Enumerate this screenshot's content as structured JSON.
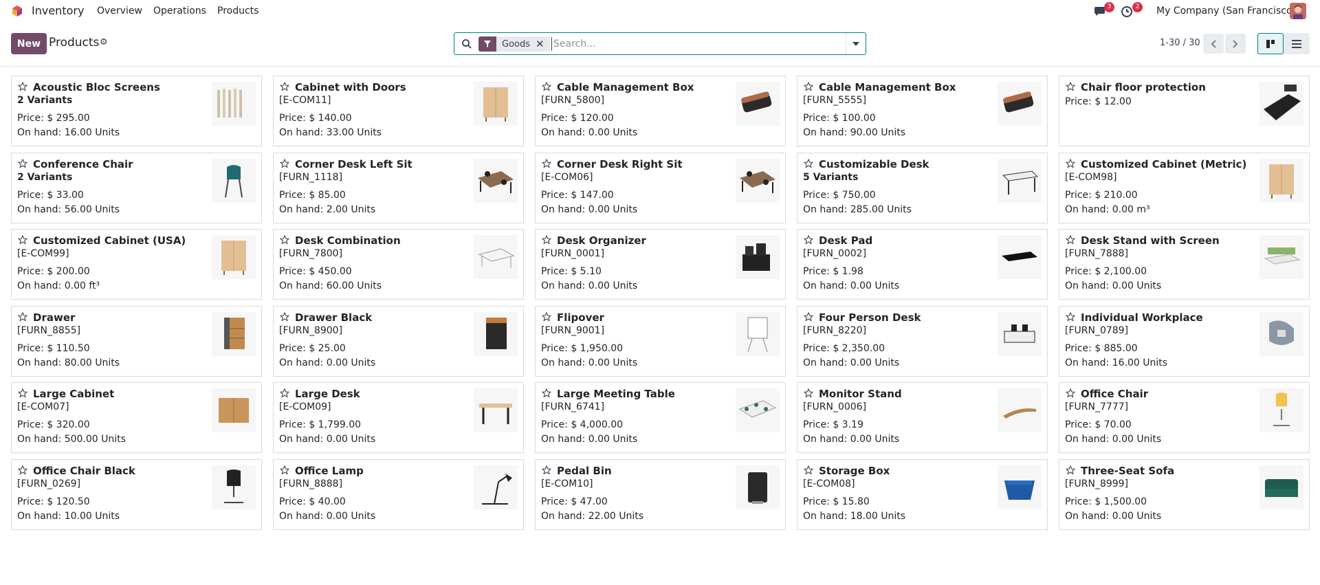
{
  "navbar": {
    "app_name": "Inventory",
    "menu": [
      "Overview",
      "Operations",
      "Products"
    ],
    "messages_count": "3",
    "activities_count": "2",
    "company": "My Company (San Francisco)"
  },
  "control": {
    "new_label": "New",
    "title": "Products",
    "facet_label": "Goods",
    "search_placeholder": "Search...",
    "pager": "1-30 / 30"
  },
  "colors": {
    "brand": "#714b67",
    "accent": "#017e84",
    "badge": "#d6334b"
  },
  "products": [
    {
      "name": "Acoustic Bloc Screens",
      "ref": "2 Variants",
      "variants": true,
      "price": "Price: $ 295.00",
      "onhand": "On hand: 16.00 Units",
      "icon": "acoustic-screen-icon"
    },
    {
      "name": "Cabinet with Doors",
      "ref": "[E-COM11]",
      "variants": false,
      "price": "Price: $ 140.00",
      "onhand": "On hand: 33.00 Units",
      "icon": "cabinet-icon"
    },
    {
      "name": "Cable Management Box",
      "ref": "[FURN_5800]",
      "variants": false,
      "price": "Price: $ 120.00",
      "onhand": "On hand: 0.00 Units",
      "icon": "cable-box-icon"
    },
    {
      "name": "Cable Management Box",
      "ref": "[FURN_5555]",
      "variants": false,
      "price": "Price: $ 100.00",
      "onhand": "On hand: 90.00 Units",
      "icon": "cable-box-icon"
    },
    {
      "name": "Chair floor protection",
      "ref": "",
      "variants": false,
      "price": "Price: $ 12.00",
      "onhand": "",
      "icon": "floor-mat-icon"
    },
    {
      "name": "Conference Chair",
      "ref": "2 Variants",
      "variants": true,
      "price": "Price: $ 33.00",
      "onhand": "On hand: 56.00 Units",
      "icon": "chair-icon"
    },
    {
      "name": "Corner Desk Left Sit",
      "ref": "[FURN_1118]",
      "variants": false,
      "price": "Price: $ 85.00",
      "onhand": "On hand: 2.00 Units",
      "icon": "corner-desk-icon"
    },
    {
      "name": "Corner Desk Right Sit",
      "ref": "[E-COM06]",
      "variants": false,
      "price": "Price: $ 147.00",
      "onhand": "On hand: 0.00 Units",
      "icon": "corner-desk-icon"
    },
    {
      "name": "Customizable Desk",
      "ref": "5 Variants",
      "variants": true,
      "price": "Price: $ 750.00",
      "onhand": "On hand: 285.00 Units",
      "icon": "desk-icon"
    },
    {
      "name": "Customized Cabinet (Metric)",
      "ref": "[E-COM98]",
      "variants": false,
      "price": "Price: $ 210.00",
      "onhand": "On hand: 0.00 m³",
      "icon": "cabinet-icon"
    },
    {
      "name": "Customized Cabinet (USA)",
      "ref": "[E-COM99]",
      "variants": false,
      "price": "Price: $ 200.00",
      "onhand": "On hand: 0.00 ft³",
      "icon": "cabinet-icon"
    },
    {
      "name": "Desk Combination",
      "ref": "[FURN_7800]",
      "variants": false,
      "price": "Price: $ 450.00",
      "onhand": "On hand: 60.00 Units",
      "icon": "desk-combination-icon"
    },
    {
      "name": "Desk Organizer",
      "ref": "[FURN_0001]",
      "variants": false,
      "price": "Price: $ 5.10",
      "onhand": "On hand: 0.00 Units",
      "icon": "organizer-icon"
    },
    {
      "name": "Desk Pad",
      "ref": "[FURN_0002]",
      "variants": false,
      "price": "Price: $ 1.98",
      "onhand": "On hand: 0.00 Units",
      "icon": "desk-pad-icon"
    },
    {
      "name": "Desk Stand with Screen",
      "ref": "[FURN_7888]",
      "variants": false,
      "price": "Price: $ 2,100.00",
      "onhand": "On hand: 0.00 Units",
      "icon": "desk-screen-icon"
    },
    {
      "name": "Drawer",
      "ref": "[FURN_8855]",
      "variants": false,
      "price": "Price: $ 110.50",
      "onhand": "On hand: 80.00 Units",
      "icon": "drawer-icon"
    },
    {
      "name": "Drawer Black",
      "ref": "[FURN_8900]",
      "variants": false,
      "price": "Price: $ 25.00",
      "onhand": "On hand: 0.00 Units",
      "icon": "drawer-black-icon"
    },
    {
      "name": "Flipover",
      "ref": "[FURN_9001]",
      "variants": false,
      "price": "Price: $ 1,950.00",
      "onhand": "On hand: 0.00 Units",
      "icon": "flipover-icon"
    },
    {
      "name": "Four Person Desk",
      "ref": "[FURN_8220]",
      "variants": false,
      "price": "Price: $ 2,350.00",
      "onhand": "On hand: 0.00 Units",
      "icon": "four-person-desk-icon"
    },
    {
      "name": "Individual Workplace",
      "ref": "[FURN_0789]",
      "variants": false,
      "price": "Price: $ 885.00",
      "onhand": "On hand: 16.00 Units",
      "icon": "workplace-icon"
    },
    {
      "name": "Large Cabinet",
      "ref": "[E-COM07]",
      "variants": false,
      "price": "Price: $ 320.00",
      "onhand": "On hand: 500.00 Units",
      "icon": "large-cabinet-icon"
    },
    {
      "name": "Large Desk",
      "ref": "[E-COM09]",
      "variants": false,
      "price": "Price: $ 1,799.00",
      "onhand": "On hand: 0.00 Units",
      "icon": "large-desk-icon"
    },
    {
      "name": "Large Meeting Table",
      "ref": "[FURN_6741]",
      "variants": false,
      "price": "Price: $ 4,000.00",
      "onhand": "On hand: 0.00 Units",
      "icon": "meeting-table-icon"
    },
    {
      "name": "Monitor Stand",
      "ref": "[FURN_0006]",
      "variants": false,
      "price": "Price: $ 3.19",
      "onhand": "On hand: 0.00 Units",
      "icon": "monitor-stand-icon"
    },
    {
      "name": "Office Chair",
      "ref": "[FURN_7777]",
      "variants": false,
      "price": "Price: $ 70.00",
      "onhand": "On hand: 0.00 Units",
      "icon": "office-chair-icon"
    },
    {
      "name": "Office Chair Black",
      "ref": "[FURN_0269]",
      "variants": false,
      "price": "Price: $ 120.50",
      "onhand": "On hand: 10.00 Units",
      "icon": "office-chair-black-icon"
    },
    {
      "name": "Office Lamp",
      "ref": "[FURN_8888]",
      "variants": false,
      "price": "Price: $ 40.00",
      "onhand": "On hand: 0.00 Units",
      "icon": "lamp-icon"
    },
    {
      "name": "Pedal Bin",
      "ref": "[E-COM10]",
      "variants": false,
      "price": "Price: $ 47.00",
      "onhand": "On hand: 22.00 Units",
      "icon": "pedal-bin-icon"
    },
    {
      "name": "Storage Box",
      "ref": "[E-COM08]",
      "variants": false,
      "price": "Price: $ 15.80",
      "onhand": "On hand: 18.00 Units",
      "icon": "storage-box-icon"
    },
    {
      "name": "Three-Seat Sofa",
      "ref": "[FURN_8999]",
      "variants": false,
      "price": "Price: $ 1,500.00",
      "onhand": "On hand: 0.00 Units",
      "icon": "sofa-icon"
    }
  ]
}
